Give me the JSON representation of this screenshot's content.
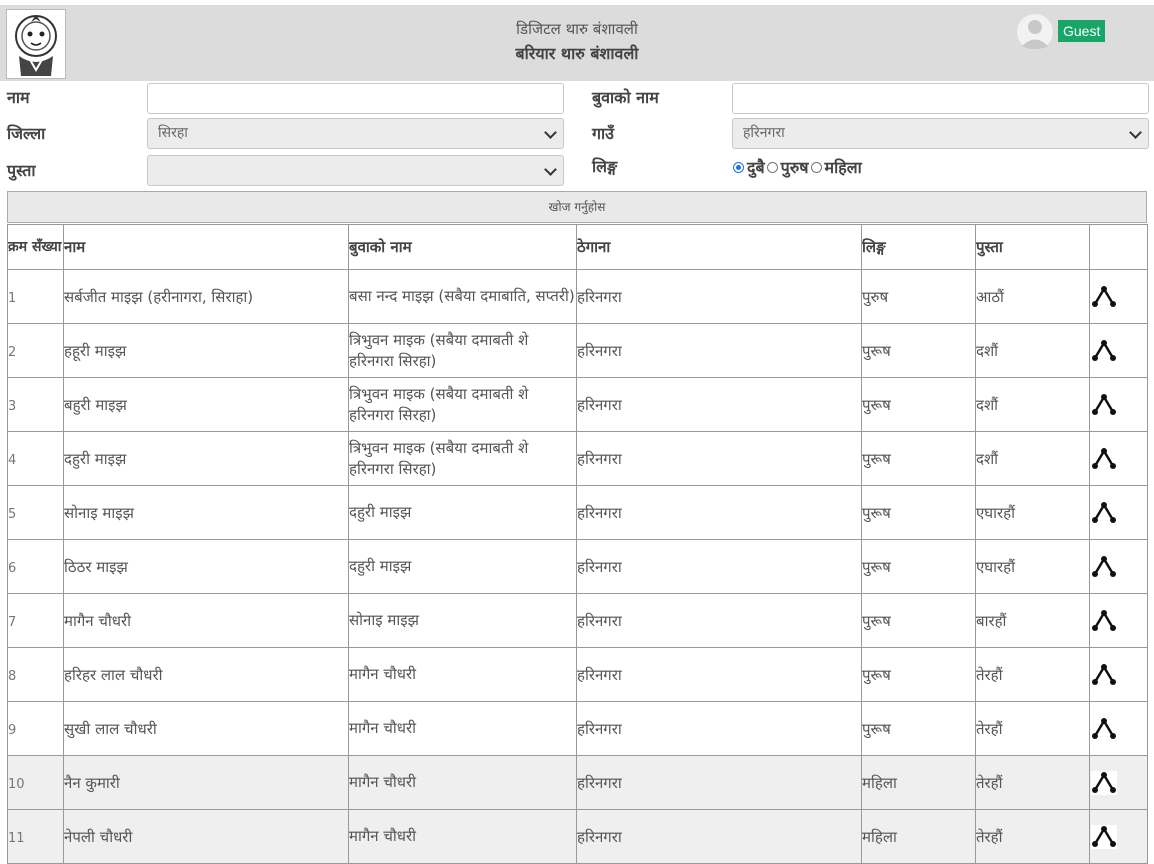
{
  "header": {
    "subtitle": "डिजिटल थारु बंशावली",
    "title": "बरियार थारु बंशावली",
    "user_label": "Guest"
  },
  "form": {
    "name_label": "नाम",
    "name_value": "",
    "father_label": "बुवाको नाम",
    "father_value": "",
    "district_label": "जिल्ला",
    "district_value": "सिरहा",
    "village_label": "गाउँ",
    "village_value": "हरिनगरा",
    "generation_label": "पुस्ता",
    "generation_value": "",
    "gender_label": "लिङ्ग",
    "gender_options": [
      "दुबै",
      "पुरुष",
      "महिला"
    ],
    "gender_selected": "दुबै",
    "search_button": "खोज गर्नुहोस"
  },
  "table": {
    "headers": [
      "क्रम सँख्या",
      "नाम",
      "बुवाको नाम",
      "ठेगाना",
      "लिङ्ग",
      "पुस्ता",
      ""
    ],
    "rows": [
      {
        "sn": "1",
        "name": "सर्बजीत माइझ (हरीनागरा, सिराहा)",
        "father": "बसा नन्द माइझ (सबैया दमाबाति, सप्तरी)",
        "address": "हरिनगरा",
        "gender": "पुरुष",
        "generation": "आठौं"
      },
      {
        "sn": "2",
        "name": "हहूरी माइझ",
        "father": "त्रिभुवन माइक (सबैया दमाबती शे हरिनगरा सिरहा)",
        "address": "हरिनगरा",
        "gender": "पुरूष",
        "generation": "दशौं"
      },
      {
        "sn": "3",
        "name": "बहुरी माइझ",
        "father": "त्रिभुवन माइक (सबैया दमाबती शे हरिनगरा सिरहा)",
        "address": "हरिनगरा",
        "gender": "पुरूष",
        "generation": "दशौं"
      },
      {
        "sn": "4",
        "name": "दहुरी माइझ",
        "father": "त्रिभुवन माइक (सबैया दमाबती शे हरिनगरा सिरहा)",
        "address": "हरिनगरा",
        "gender": "पुरूष",
        "generation": "दशौं"
      },
      {
        "sn": "5",
        "name": "सोनाइ माइझ",
        "father": "दहुरी माइझ",
        "address": "हरिनगरा",
        "gender": "पुरूष",
        "generation": "एघारहौं"
      },
      {
        "sn": "6",
        "name": "ठिठर माइझ",
        "father": "दहुरी माइझ",
        "address": "हरिनगरा",
        "gender": "पुरूष",
        "generation": "एघारहौं"
      },
      {
        "sn": "7",
        "name": "मागैन चौधरी",
        "father": "सोनाइ माइझ",
        "address": "हरिनगरा",
        "gender": "पुरूष",
        "generation": "बारहौं"
      },
      {
        "sn": "8",
        "name": "हरिहर लाल चौधरी",
        "father": "मागैन चौधरी",
        "address": "हरिनगरा",
        "gender": "पुरूष",
        "generation": "तेरहौं"
      },
      {
        "sn": "9",
        "name": "सुखी लाल चौधरी",
        "father": "मागैन चौधरी",
        "address": "हरिनगरा",
        "gender": "पुरूष",
        "generation": "तेरहौं"
      },
      {
        "sn": "10",
        "name": "नैन कुमारी",
        "father": "मागैन चौधरी",
        "address": "हरिनगरा",
        "gender": "महिला",
        "generation": "तेरहौं"
      },
      {
        "sn": "11",
        "name": "नेपली चौधरी",
        "father": "मागैन चौधरी",
        "address": "हरिनगरा",
        "gender": "महिला",
        "generation": "तेरहौं"
      }
    ],
    "row_icon": "family-tree-icon"
  }
}
